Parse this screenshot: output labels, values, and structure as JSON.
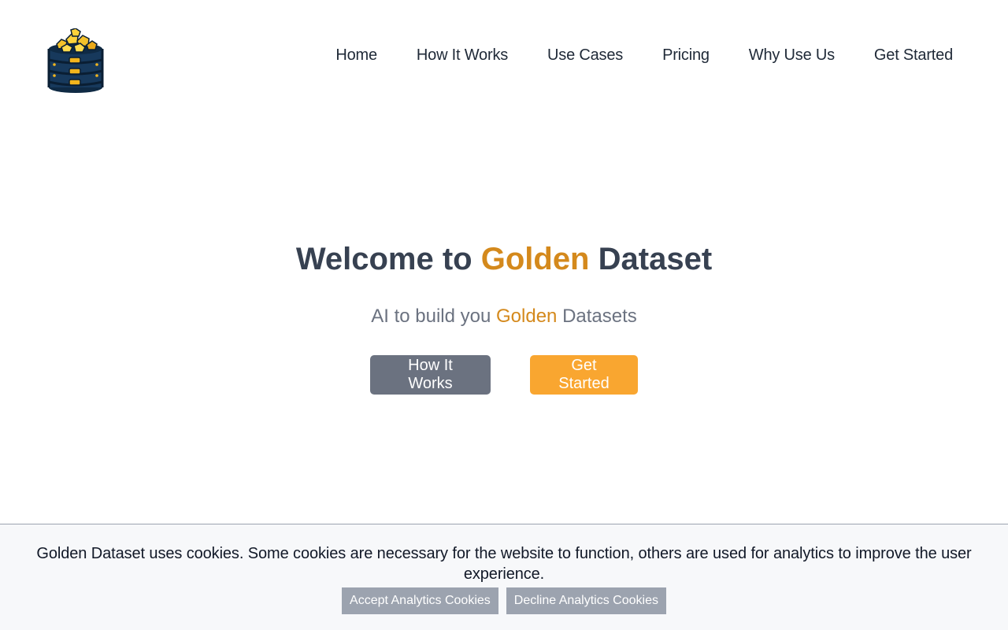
{
  "header": {
    "logo_alt": "Golden Dataset logo",
    "nav": [
      {
        "label": "Home"
      },
      {
        "label": "How It Works"
      },
      {
        "label": "Use Cases"
      },
      {
        "label": "Pricing"
      },
      {
        "label": "Why Use Us"
      },
      {
        "label": "Get Started"
      }
    ]
  },
  "hero": {
    "title_prefix": "Welcome to",
    "title_highlight": "Golden",
    "title_suffix": "Dataset",
    "subtitle_prefix": "AI to build you",
    "subtitle_highlight": "Golden",
    "subtitle_suffix": "Datasets",
    "primary_button": "How It Works",
    "secondary_button": "Get Started"
  },
  "cookie_banner": {
    "message": "Golden Dataset uses cookies. Some cookies are necessary for the website to function, others are used for analytics to improve the user experience.",
    "accept_label": "Accept Analytics Cookies",
    "decline_label": "Decline Analytics Cookies"
  },
  "colors": {
    "gold_accent": "#d4891c",
    "gold_button": "#f9a630",
    "gray_button": "#6b7280",
    "title_text": "#374151",
    "cookie_button": "#9ca3af"
  }
}
